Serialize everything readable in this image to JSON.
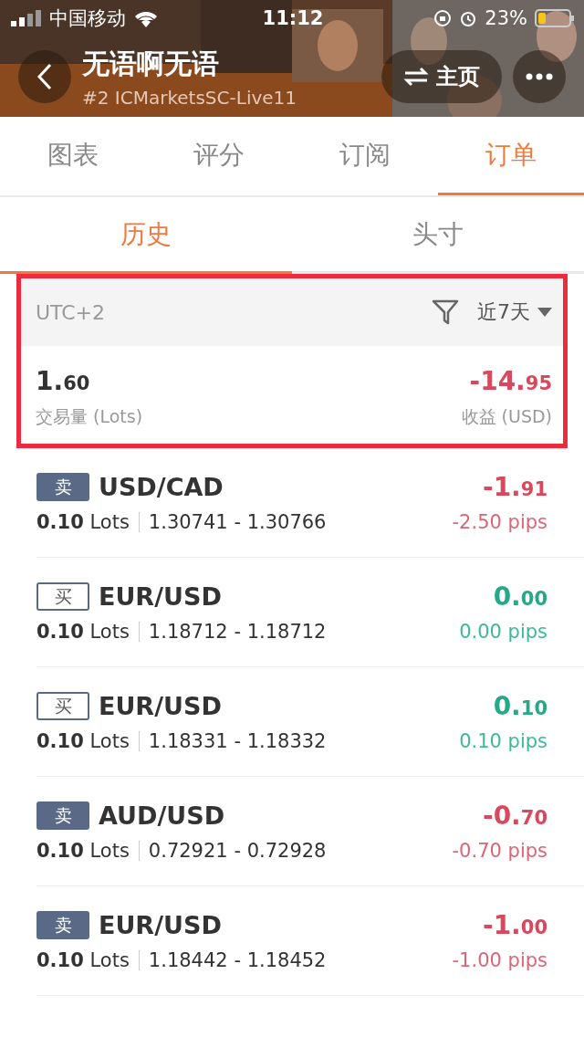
{
  "status_bar": {
    "carrier": "中国移动",
    "time": "11:12",
    "battery": "23%"
  },
  "header": {
    "title": "无语啊无语",
    "subtitle": "#2 ICMarketsSC-Live11",
    "home_button": "主页"
  },
  "tabs": [
    {
      "label": "图表",
      "selected": false
    },
    {
      "label": "评分",
      "selected": false
    },
    {
      "label": "订阅",
      "selected": false
    },
    {
      "label": "订单",
      "selected": true
    }
  ],
  "subtabs": [
    {
      "label": "历史",
      "selected": true
    },
    {
      "label": "头寸",
      "selected": false
    }
  ],
  "filter": {
    "timezone": "UTC+2",
    "period": "近7天"
  },
  "summary": {
    "volume": {
      "whole": "1.",
      "fraction": "60"
    },
    "volume_label": "交易量 (Lots)",
    "profit": {
      "whole": "-14.",
      "fraction": "95"
    },
    "profit_label": "收益 (USD)",
    "loss": true
  },
  "orders": [
    {
      "sell": true,
      "side_label": "卖",
      "pair": "USD/CAD",
      "lots": "**0.10** Lots",
      "prices": "1.30741 - 1.30766",
      "profit": {
        "whole": "-1.",
        "fraction": "91"
      },
      "pips": "-2.50 pips",
      "loss": true
    },
    {
      "sell": false,
      "side_label": "买",
      "pair": "EUR/USD",
      "lots": "**0.10** Lots",
      "prices": "1.18712 - 1.18712",
      "profit": {
        "whole": "0.",
        "fraction": "00"
      },
      "pips": "0.00 pips",
      "loss": false
    },
    {
      "sell": false,
      "side_label": "买",
      "pair": "EUR/USD",
      "lots": "**0.10** Lots",
      "prices": "1.18331 - 1.18332",
      "profit": {
        "whole": "0.",
        "fraction": "10"
      },
      "pips": "0.10 pips",
      "loss": false
    },
    {
      "sell": true,
      "side_label": "卖",
      "pair": "AUD/USD",
      "lots": "**0.10** Lots",
      "prices": "0.72921 - 0.72928",
      "profit": {
        "whole": "-0.",
        "fraction": "70"
      },
      "pips": "-0.70 pips",
      "loss": true
    },
    {
      "sell": true,
      "side_label": "卖",
      "pair": "EUR/USD",
      "lots": "**0.10** Lots",
      "prices": "1.18442 - 1.18452",
      "profit": {
        "whole": "-1.",
        "fraction": "00"
      },
      "pips": "-1.00 pips",
      "loss": true
    }
  ]
}
